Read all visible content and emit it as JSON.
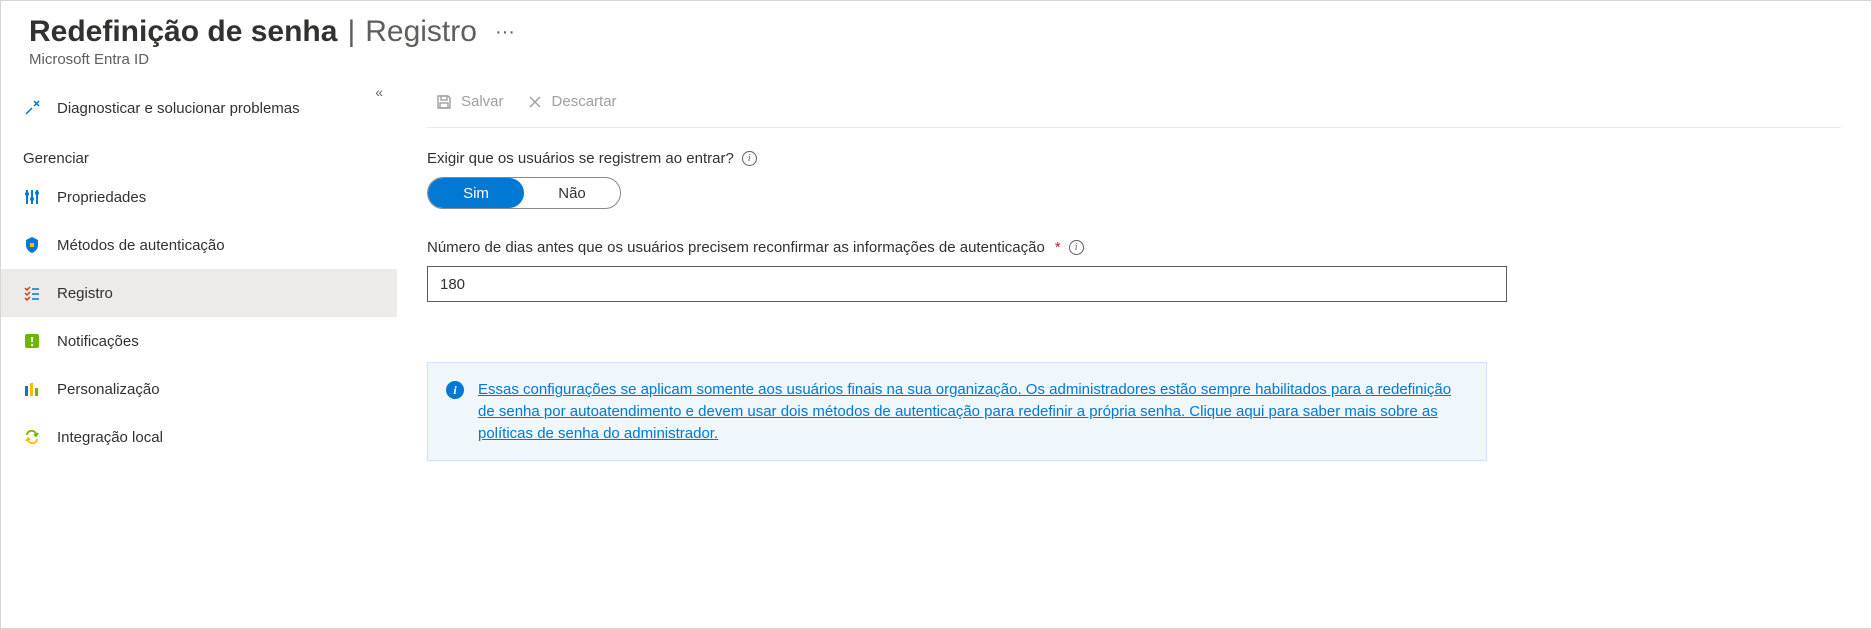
{
  "header": {
    "title_main": "Redefinição de senha",
    "title_sep": " | ",
    "title_sub": "Registro",
    "ellipsis": "···",
    "subtitle": "Microsoft Entra ID"
  },
  "sidebar": {
    "collapse_glyph": "«",
    "diagnose": "Diagnosticar e solucionar problemas",
    "section_manage": "Gerenciar",
    "items": {
      "properties": "Propriedades",
      "auth_methods": "Métodos de autenticação",
      "registration": "Registro",
      "notifications": "Notificações",
      "customization": "Personalização",
      "onprem": "Integração local"
    }
  },
  "toolbar": {
    "save": "Salvar",
    "discard": "Descartar"
  },
  "form": {
    "require_register_label": "Exigir que os usuários se registrem ao entrar?",
    "toggle_yes": "Sim",
    "toggle_no": "Não",
    "reconfirm_label": "Número de dias antes que os usuários precisem reconfirmar as informações de autenticação",
    "reconfirm_value": "180"
  },
  "banner": {
    "text": "Essas configurações se aplicam somente aos usuários finais na sua organização. Os administradores estão sempre habilitados para a redefinição de senha por autoatendimento e devem usar dois métodos de autenticação para redefinir a própria senha. Clique aqui para saber mais sobre as políticas de senha do administrador."
  }
}
